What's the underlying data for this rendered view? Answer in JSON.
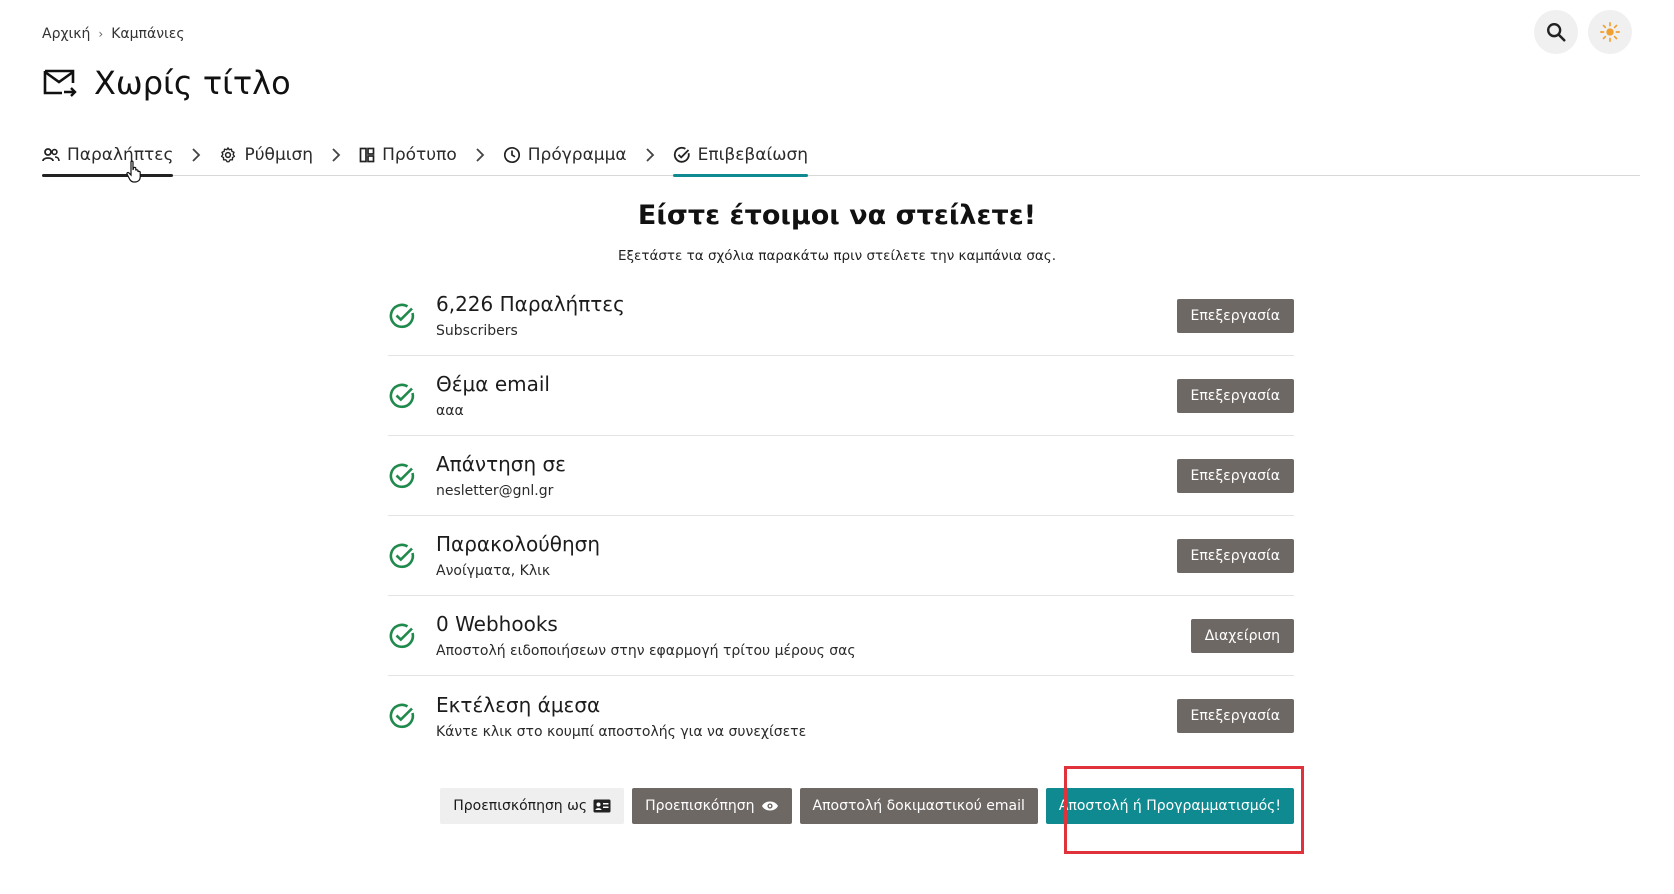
{
  "breadcrumb": {
    "home": "Αρχική",
    "separator": "›",
    "campaigns": "Καμπάνιες"
  },
  "page": {
    "title": "Χωρίς τίτλο"
  },
  "tabs": [
    {
      "label": "Παραλήπτες",
      "icon": "users-icon"
    },
    {
      "label": "Ρύθμιση",
      "icon": "gear-icon"
    },
    {
      "label": "Πρότυπο",
      "icon": "layout-icon"
    },
    {
      "label": "Πρόγραμμα",
      "icon": "clock-icon"
    },
    {
      "label": "Επιβεβαίωση",
      "icon": "check-circle-icon"
    }
  ],
  "main": {
    "heading": "Είστε έτοιμοι να στείλετε!",
    "subheading": "Εξετάστε τα σχόλια παρακάτω πριν στείλετε την καμπάνια σας."
  },
  "checklist": [
    {
      "title": "6,226 Παραλήπτες",
      "subtitle": "Subscribers",
      "action": "Επεξεργασία"
    },
    {
      "title": "Θέμα email",
      "subtitle": "ααα",
      "action": "Επεξεργασία"
    },
    {
      "title": "Απάντηση σε",
      "subtitle": "nesletter@gnl.gr",
      "action": "Επεξεργασία"
    },
    {
      "title": "Παρακολούθηση",
      "subtitle": "Ανοίγματα, Κλικ",
      "action": "Επεξεργασία"
    },
    {
      "title": "0 Webhooks",
      "subtitle": "Αποστολή ειδοποιήσεων στην εφαρμογή τρίτου μέρους σας",
      "action": "Διαχείριση"
    },
    {
      "title": "Εκτέλεση άμεσα",
      "subtitle": "Κάντε κλικ στο κουμπί αποστολής για να συνεχίσετε",
      "action": "Επεξεργασία"
    }
  ],
  "actions": {
    "preview_as": "Προεπισκόπηση ως",
    "preview": "Προεπισκόπηση",
    "send_test": "Αποστολή δοκιμαστικού email",
    "send_or_schedule": "Αποστολή ή Προγραμματισμός!"
  },
  "colors": {
    "accent": "#0e8a90",
    "check_green": "#1f8a4c",
    "button_gray": "#6e6865",
    "highlight_red": "#e0323a",
    "sun_orange": "#f0a030"
  }
}
